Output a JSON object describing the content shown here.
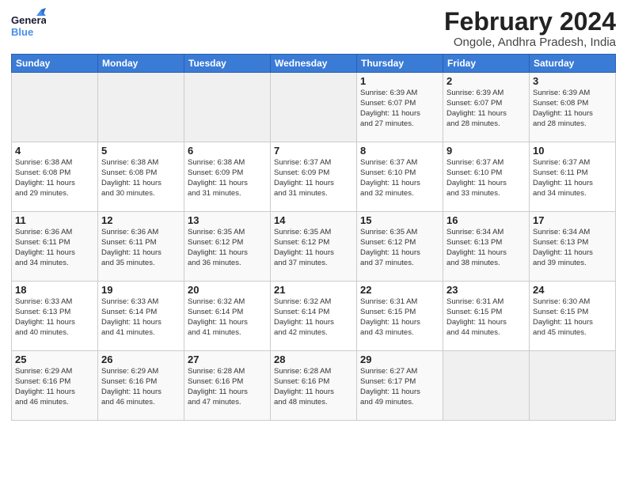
{
  "header": {
    "logo_line1": "General",
    "logo_line2": "Blue",
    "month_title": "February 2024",
    "location": "Ongole, Andhra Pradesh, India"
  },
  "days_of_week": [
    "Sunday",
    "Monday",
    "Tuesday",
    "Wednesday",
    "Thursday",
    "Friday",
    "Saturday"
  ],
  "weeks": [
    [
      {
        "day": "",
        "info": ""
      },
      {
        "day": "",
        "info": ""
      },
      {
        "day": "",
        "info": ""
      },
      {
        "day": "",
        "info": ""
      },
      {
        "day": "1",
        "info": "Sunrise: 6:39 AM\nSunset: 6:07 PM\nDaylight: 11 hours\nand 27 minutes."
      },
      {
        "day": "2",
        "info": "Sunrise: 6:39 AM\nSunset: 6:07 PM\nDaylight: 11 hours\nand 28 minutes."
      },
      {
        "day": "3",
        "info": "Sunrise: 6:39 AM\nSunset: 6:08 PM\nDaylight: 11 hours\nand 28 minutes."
      }
    ],
    [
      {
        "day": "4",
        "info": "Sunrise: 6:38 AM\nSunset: 6:08 PM\nDaylight: 11 hours\nand 29 minutes."
      },
      {
        "day": "5",
        "info": "Sunrise: 6:38 AM\nSunset: 6:08 PM\nDaylight: 11 hours\nand 30 minutes."
      },
      {
        "day": "6",
        "info": "Sunrise: 6:38 AM\nSunset: 6:09 PM\nDaylight: 11 hours\nand 31 minutes."
      },
      {
        "day": "7",
        "info": "Sunrise: 6:37 AM\nSunset: 6:09 PM\nDaylight: 11 hours\nand 31 minutes."
      },
      {
        "day": "8",
        "info": "Sunrise: 6:37 AM\nSunset: 6:10 PM\nDaylight: 11 hours\nand 32 minutes."
      },
      {
        "day": "9",
        "info": "Sunrise: 6:37 AM\nSunset: 6:10 PM\nDaylight: 11 hours\nand 33 minutes."
      },
      {
        "day": "10",
        "info": "Sunrise: 6:37 AM\nSunset: 6:11 PM\nDaylight: 11 hours\nand 34 minutes."
      }
    ],
    [
      {
        "day": "11",
        "info": "Sunrise: 6:36 AM\nSunset: 6:11 PM\nDaylight: 11 hours\nand 34 minutes."
      },
      {
        "day": "12",
        "info": "Sunrise: 6:36 AM\nSunset: 6:11 PM\nDaylight: 11 hours\nand 35 minutes."
      },
      {
        "day": "13",
        "info": "Sunrise: 6:35 AM\nSunset: 6:12 PM\nDaylight: 11 hours\nand 36 minutes."
      },
      {
        "day": "14",
        "info": "Sunrise: 6:35 AM\nSunset: 6:12 PM\nDaylight: 11 hours\nand 37 minutes."
      },
      {
        "day": "15",
        "info": "Sunrise: 6:35 AM\nSunset: 6:12 PM\nDaylight: 11 hours\nand 37 minutes."
      },
      {
        "day": "16",
        "info": "Sunrise: 6:34 AM\nSunset: 6:13 PM\nDaylight: 11 hours\nand 38 minutes."
      },
      {
        "day": "17",
        "info": "Sunrise: 6:34 AM\nSunset: 6:13 PM\nDaylight: 11 hours\nand 39 minutes."
      }
    ],
    [
      {
        "day": "18",
        "info": "Sunrise: 6:33 AM\nSunset: 6:13 PM\nDaylight: 11 hours\nand 40 minutes."
      },
      {
        "day": "19",
        "info": "Sunrise: 6:33 AM\nSunset: 6:14 PM\nDaylight: 11 hours\nand 41 minutes."
      },
      {
        "day": "20",
        "info": "Sunrise: 6:32 AM\nSunset: 6:14 PM\nDaylight: 11 hours\nand 41 minutes."
      },
      {
        "day": "21",
        "info": "Sunrise: 6:32 AM\nSunset: 6:14 PM\nDaylight: 11 hours\nand 42 minutes."
      },
      {
        "day": "22",
        "info": "Sunrise: 6:31 AM\nSunset: 6:15 PM\nDaylight: 11 hours\nand 43 minutes."
      },
      {
        "day": "23",
        "info": "Sunrise: 6:31 AM\nSunset: 6:15 PM\nDaylight: 11 hours\nand 44 minutes."
      },
      {
        "day": "24",
        "info": "Sunrise: 6:30 AM\nSunset: 6:15 PM\nDaylight: 11 hours\nand 45 minutes."
      }
    ],
    [
      {
        "day": "25",
        "info": "Sunrise: 6:29 AM\nSunset: 6:16 PM\nDaylight: 11 hours\nand 46 minutes."
      },
      {
        "day": "26",
        "info": "Sunrise: 6:29 AM\nSunset: 6:16 PM\nDaylight: 11 hours\nand 46 minutes."
      },
      {
        "day": "27",
        "info": "Sunrise: 6:28 AM\nSunset: 6:16 PM\nDaylight: 11 hours\nand 47 minutes."
      },
      {
        "day": "28",
        "info": "Sunrise: 6:28 AM\nSunset: 6:16 PM\nDaylight: 11 hours\nand 48 minutes."
      },
      {
        "day": "29",
        "info": "Sunrise: 6:27 AM\nSunset: 6:17 PM\nDaylight: 11 hours\nand 49 minutes."
      },
      {
        "day": "",
        "info": ""
      },
      {
        "day": "",
        "info": ""
      }
    ]
  ]
}
